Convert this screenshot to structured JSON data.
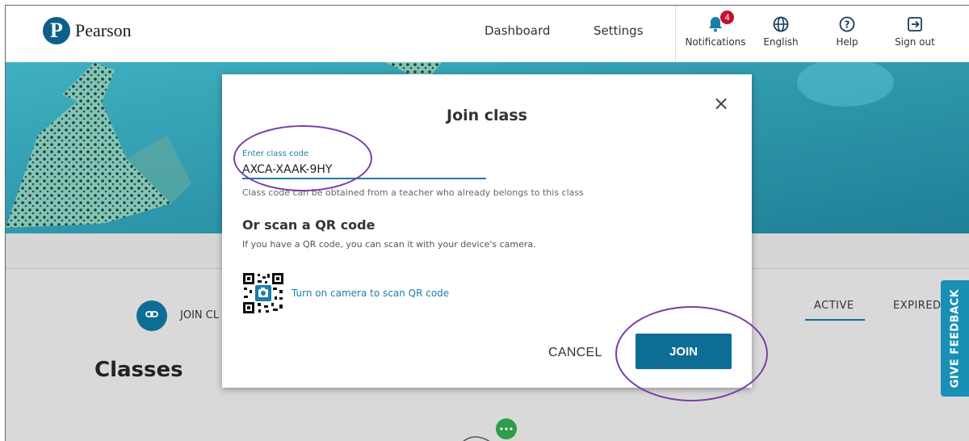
{
  "header": {
    "brand": "Pearson",
    "nav": {
      "dashboard": "Dashboard",
      "settings": "Settings"
    },
    "notifications": {
      "label": "Notifications",
      "count": "4"
    },
    "language": {
      "label": "English"
    },
    "help": {
      "label": "Help"
    },
    "signout": {
      "label": "Sign out"
    }
  },
  "page": {
    "join_class_label": "JOIN CL",
    "classes_title": "Classes",
    "tabs": {
      "active": "ACTIVE",
      "expired": "EXPIRED"
    },
    "feedback_label": "GIVE FEEDBACK"
  },
  "modal": {
    "title": "Join class",
    "field_label": "Enter class code",
    "field_value": "AXCA-XAAK-9HY",
    "helper_text": "Class code can be obtained from a teacher who already belongs to this class",
    "qr_heading": "Or scan a QR code",
    "qr_description": "If you have a QR code, you can scan it with your device's camera.",
    "camera_link": "Turn on camera to scan QR code",
    "cancel_label": "CANCEL",
    "join_label": "JOIN"
  },
  "colors": {
    "brand": "#0d6d95",
    "link": "#1a7ea8",
    "badge": "#c41230",
    "feedback_tab": "#1a8fb5",
    "annotation": "#7a3ea6"
  },
  "icons": {
    "notifications": "bell-icon",
    "language": "globe-icon",
    "help": "help-icon",
    "signout": "sign-out-icon",
    "join_class": "link-icon",
    "close": "close-icon",
    "qr": "qr-code-icon"
  }
}
